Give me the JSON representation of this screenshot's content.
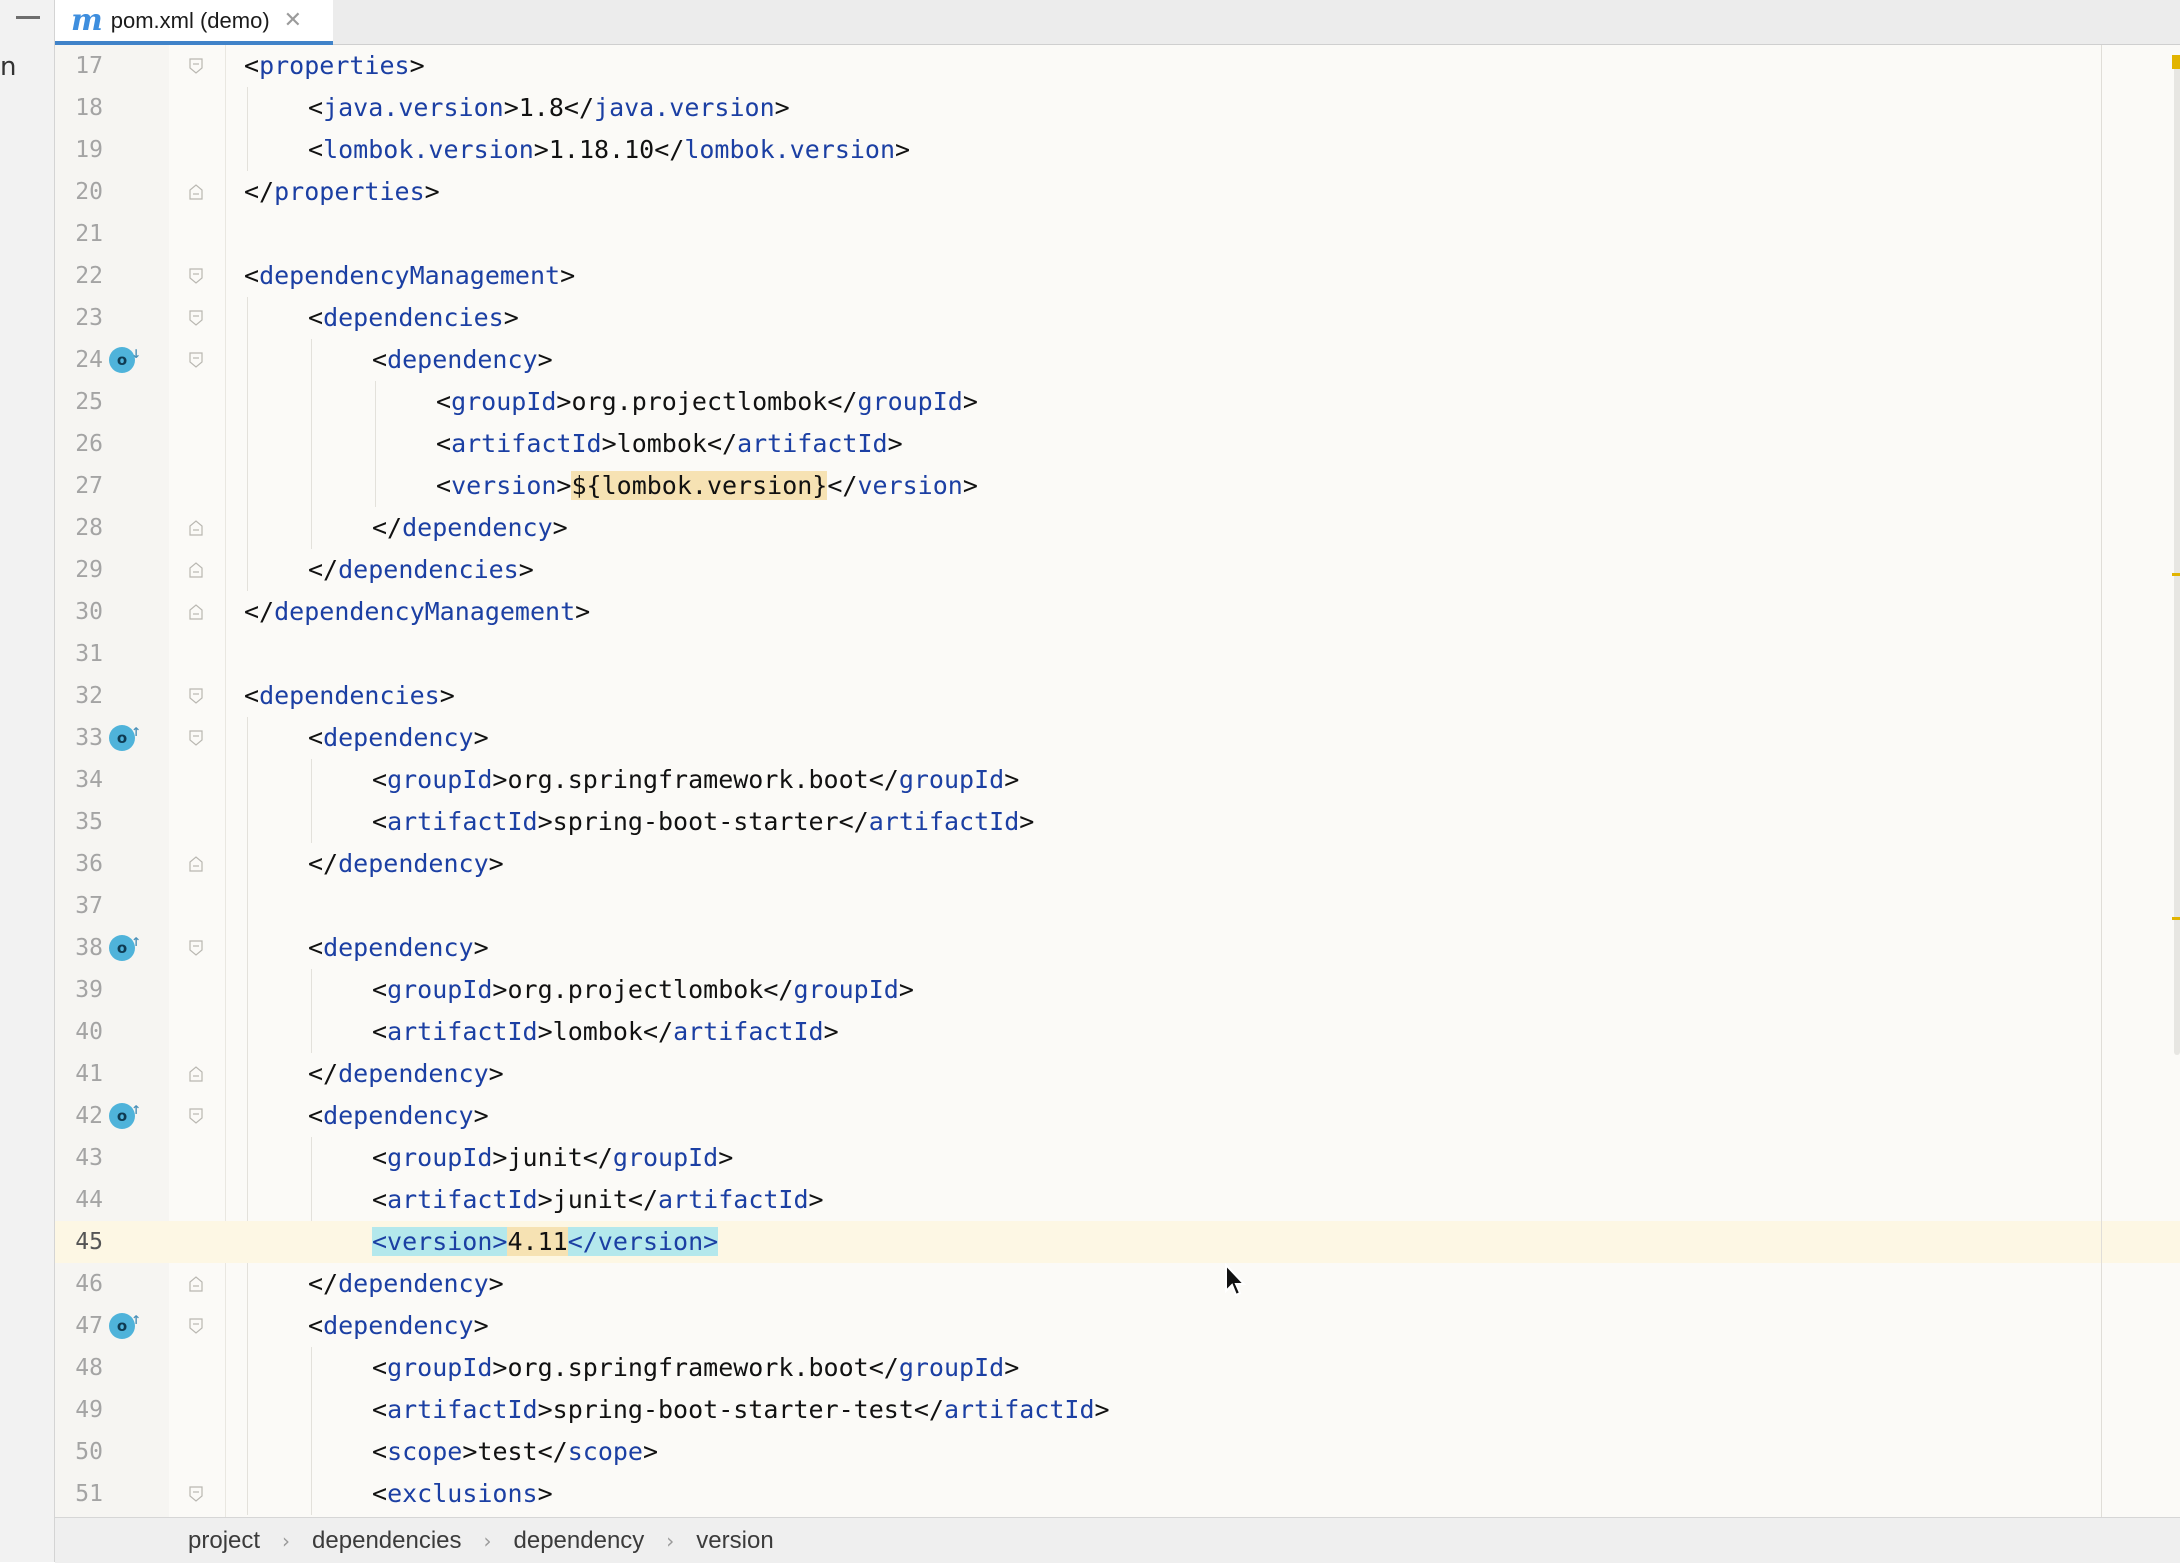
{
  "tab": {
    "icon_label": "m",
    "title": "pom.xml (demo)"
  },
  "left_strip": {
    "letter": "n"
  },
  "lines": [
    {
      "n": "17",
      "indent": 1,
      "fold": "open",
      "icon": null,
      "parts": [
        [
          "br",
          "<"
        ],
        [
          "tag",
          "properties"
        ],
        [
          "br",
          ">"
        ]
      ]
    },
    {
      "n": "18",
      "indent": 2,
      "fold": null,
      "icon": null,
      "parts": [
        [
          "br",
          "<"
        ],
        [
          "tag",
          "java.version"
        ],
        [
          "br",
          ">"
        ],
        [
          "val",
          "1.8"
        ],
        [
          "br",
          "</"
        ],
        [
          "tag",
          "java.version"
        ],
        [
          "br",
          ">"
        ]
      ]
    },
    {
      "n": "19",
      "indent": 2,
      "fold": null,
      "icon": null,
      "parts": [
        [
          "br",
          "<"
        ],
        [
          "tag",
          "lombok.version"
        ],
        [
          "br",
          ">"
        ],
        [
          "val",
          "1.18.10"
        ],
        [
          "br",
          "</"
        ],
        [
          "tag",
          "lombok.version"
        ],
        [
          "br",
          ">"
        ]
      ]
    },
    {
      "n": "20",
      "indent": 1,
      "fold": "close",
      "icon": null,
      "parts": [
        [
          "br",
          "</"
        ],
        [
          "tag",
          "properties"
        ],
        [
          "br",
          ">"
        ]
      ]
    },
    {
      "n": "21",
      "indent": 0,
      "fold": null,
      "icon": null,
      "parts": []
    },
    {
      "n": "22",
      "indent": 1,
      "fold": "open",
      "icon": null,
      "parts": [
        [
          "br",
          "<"
        ],
        [
          "tag",
          "dependencyManagement"
        ],
        [
          "br",
          ">"
        ]
      ]
    },
    {
      "n": "23",
      "indent": 2,
      "fold": "open",
      "icon": null,
      "parts": [
        [
          "br",
          "<"
        ],
        [
          "tag",
          "dependencies"
        ],
        [
          "br",
          ">"
        ]
      ]
    },
    {
      "n": "24",
      "indent": 3,
      "fold": "open",
      "icon": "down",
      "parts": [
        [
          "br",
          "<"
        ],
        [
          "tag",
          "dependency"
        ],
        [
          "br",
          ">"
        ]
      ]
    },
    {
      "n": "25",
      "indent": 4,
      "fold": null,
      "icon": null,
      "parts": [
        [
          "br",
          "<"
        ],
        [
          "tag",
          "groupId"
        ],
        [
          "br",
          ">"
        ],
        [
          "val",
          "org.projectlombok"
        ],
        [
          "br",
          "</"
        ],
        [
          "tag",
          "groupId"
        ],
        [
          "br",
          ">"
        ]
      ]
    },
    {
      "n": "26",
      "indent": 4,
      "fold": null,
      "icon": null,
      "parts": [
        [
          "br",
          "<"
        ],
        [
          "tag",
          "artifactId"
        ],
        [
          "br",
          ">"
        ],
        [
          "val",
          "lombok"
        ],
        [
          "br",
          "</"
        ],
        [
          "tag",
          "artifactId"
        ],
        [
          "br",
          ">"
        ]
      ]
    },
    {
      "n": "27",
      "indent": 4,
      "fold": null,
      "icon": null,
      "parts": [
        [
          "br",
          "<"
        ],
        [
          "tag",
          "version"
        ],
        [
          "br",
          ">"
        ],
        [
          "prop",
          "${lombok.version}"
        ],
        [
          "br",
          "</"
        ],
        [
          "tag",
          "version"
        ],
        [
          "br",
          ">"
        ]
      ]
    },
    {
      "n": "28",
      "indent": 3,
      "fold": "close",
      "icon": null,
      "parts": [
        [
          "br",
          "</"
        ],
        [
          "tag",
          "dependency"
        ],
        [
          "br",
          ">"
        ]
      ]
    },
    {
      "n": "29",
      "indent": 2,
      "fold": "close",
      "icon": null,
      "parts": [
        [
          "br",
          "</"
        ],
        [
          "tag",
          "dependencies"
        ],
        [
          "br",
          ">"
        ]
      ]
    },
    {
      "n": "30",
      "indent": 1,
      "fold": "close",
      "icon": null,
      "parts": [
        [
          "br",
          "</"
        ],
        [
          "tag",
          "dependencyManagement"
        ],
        [
          "br",
          ">"
        ]
      ]
    },
    {
      "n": "31",
      "indent": 0,
      "fold": null,
      "icon": null,
      "parts": []
    },
    {
      "n": "32",
      "indent": 1,
      "fold": "open",
      "icon": null,
      "parts": [
        [
          "br",
          "<"
        ],
        [
          "tag",
          "dependencies"
        ],
        [
          "br",
          ">"
        ]
      ]
    },
    {
      "n": "33",
      "indent": 2,
      "fold": "open",
      "icon": "up",
      "parts": [
        [
          "br",
          "<"
        ],
        [
          "tag",
          "dependency"
        ],
        [
          "br",
          ">"
        ]
      ]
    },
    {
      "n": "34",
      "indent": 3,
      "fold": null,
      "icon": null,
      "parts": [
        [
          "br",
          "<"
        ],
        [
          "tag",
          "groupId"
        ],
        [
          "br",
          ">"
        ],
        [
          "val",
          "org.springframework.boot"
        ],
        [
          "br",
          "</"
        ],
        [
          "tag",
          "groupId"
        ],
        [
          "br",
          ">"
        ]
      ]
    },
    {
      "n": "35",
      "indent": 3,
      "fold": null,
      "icon": null,
      "parts": [
        [
          "br",
          "<"
        ],
        [
          "tag",
          "artifactId"
        ],
        [
          "br",
          ">"
        ],
        [
          "val",
          "spring-boot-starter"
        ],
        [
          "br",
          "</"
        ],
        [
          "tag",
          "artifactId"
        ],
        [
          "br",
          ">"
        ]
      ]
    },
    {
      "n": "36",
      "indent": 2,
      "fold": "close",
      "icon": null,
      "parts": [
        [
          "br",
          "</"
        ],
        [
          "tag",
          "dependency"
        ],
        [
          "br",
          ">"
        ]
      ]
    },
    {
      "n": "37",
      "indent": 0,
      "fold": null,
      "icon": null,
      "parts": []
    },
    {
      "n": "38",
      "indent": 2,
      "fold": "open",
      "icon": "up",
      "parts": [
        [
          "br",
          "<"
        ],
        [
          "tag",
          "dependency"
        ],
        [
          "br",
          ">"
        ]
      ]
    },
    {
      "n": "39",
      "indent": 3,
      "fold": null,
      "icon": null,
      "parts": [
        [
          "br",
          "<"
        ],
        [
          "tag",
          "groupId"
        ],
        [
          "br",
          ">"
        ],
        [
          "val",
          "org.projectlombok"
        ],
        [
          "br",
          "</"
        ],
        [
          "tag",
          "groupId"
        ],
        [
          "br",
          ">"
        ]
      ]
    },
    {
      "n": "40",
      "indent": 3,
      "fold": null,
      "icon": null,
      "parts": [
        [
          "br",
          "<"
        ],
        [
          "tag",
          "artifactId"
        ],
        [
          "br",
          ">"
        ],
        [
          "val",
          "lombok"
        ],
        [
          "br",
          "</"
        ],
        [
          "tag",
          "artifactId"
        ],
        [
          "br",
          ">"
        ]
      ]
    },
    {
      "n": "41",
      "indent": 2,
      "fold": "close",
      "icon": null,
      "parts": [
        [
          "br",
          "</"
        ],
        [
          "tag",
          "dependency"
        ],
        [
          "br",
          ">"
        ]
      ]
    },
    {
      "n": "42",
      "indent": 2,
      "fold": "open",
      "icon": "up",
      "parts": [
        [
          "br",
          "<"
        ],
        [
          "tag",
          "dependency"
        ],
        [
          "br",
          ">"
        ]
      ]
    },
    {
      "n": "43",
      "indent": 3,
      "fold": null,
      "icon": null,
      "parts": [
        [
          "br",
          "<"
        ],
        [
          "tag",
          "groupId"
        ],
        [
          "br",
          ">"
        ],
        [
          "val",
          "junit"
        ],
        [
          "br",
          "</"
        ],
        [
          "tag",
          "groupId"
        ],
        [
          "br",
          ">"
        ]
      ]
    },
    {
      "n": "44",
      "indent": 3,
      "fold": null,
      "icon": null,
      "parts": [
        [
          "br",
          "<"
        ],
        [
          "tag",
          "artifactId"
        ],
        [
          "br",
          ">"
        ],
        [
          "val",
          "junit"
        ],
        [
          "br",
          "</"
        ],
        [
          "tag",
          "artifactId"
        ],
        [
          "br",
          ">"
        ]
      ]
    },
    {
      "n": "45",
      "indent": 3,
      "fold": null,
      "icon": null,
      "current": true,
      "parts": [
        [
          "hltag",
          "<version>"
        ],
        [
          "hlval",
          "4.11"
        ],
        [
          "hltag",
          "</version>"
        ]
      ]
    },
    {
      "n": "46",
      "indent": 2,
      "fold": "close",
      "icon": null,
      "parts": [
        [
          "br",
          "</"
        ],
        [
          "tag",
          "dependency"
        ],
        [
          "br",
          ">"
        ]
      ]
    },
    {
      "n": "47",
      "indent": 2,
      "fold": "open",
      "icon": "up",
      "parts": [
        [
          "br",
          "<"
        ],
        [
          "tag",
          "dependency"
        ],
        [
          "br",
          ">"
        ]
      ]
    },
    {
      "n": "48",
      "indent": 3,
      "fold": null,
      "icon": null,
      "parts": [
        [
          "br",
          "<"
        ],
        [
          "tag",
          "groupId"
        ],
        [
          "br",
          ">"
        ],
        [
          "val",
          "org.springframework.boot"
        ],
        [
          "br",
          "</"
        ],
        [
          "tag",
          "groupId"
        ],
        [
          "br",
          ">"
        ]
      ]
    },
    {
      "n": "49",
      "indent": 3,
      "fold": null,
      "icon": null,
      "parts": [
        [
          "br",
          "<"
        ],
        [
          "tag",
          "artifactId"
        ],
        [
          "br",
          ">"
        ],
        [
          "val",
          "spring-boot-starter-test"
        ],
        [
          "br",
          "</"
        ],
        [
          "tag",
          "artifactId"
        ],
        [
          "br",
          ">"
        ]
      ]
    },
    {
      "n": "50",
      "indent": 3,
      "fold": null,
      "icon": null,
      "parts": [
        [
          "br",
          "<"
        ],
        [
          "tag",
          "scope"
        ],
        [
          "br",
          ">"
        ],
        [
          "val",
          "test"
        ],
        [
          "br",
          "</"
        ],
        [
          "tag",
          "scope"
        ],
        [
          "br",
          ">"
        ]
      ]
    },
    {
      "n": "51",
      "indent": 3,
      "fold": "open",
      "icon": null,
      "parts": [
        [
          "br",
          "<"
        ],
        [
          "tag",
          "exclusions"
        ],
        [
          "br",
          ">"
        ]
      ]
    }
  ],
  "gutter_icon": {
    "glyph": "o",
    "arrow_up": "↑",
    "arrow_down": "↓"
  },
  "breadcrumb": [
    "project",
    "dependencies",
    "dependency",
    "version"
  ],
  "breadcrumb_separator": "›",
  "colors": {
    "tag": "#1b3fa3",
    "text": "#111111",
    "current_line": "#fdf7e4",
    "tag_highlight": "#b4e8ec",
    "value_highlight": "#f6e2b3",
    "tab_underline": "#4083c9",
    "gutter_icon": "#4fb3da",
    "warning_marker": "#e2b400"
  }
}
